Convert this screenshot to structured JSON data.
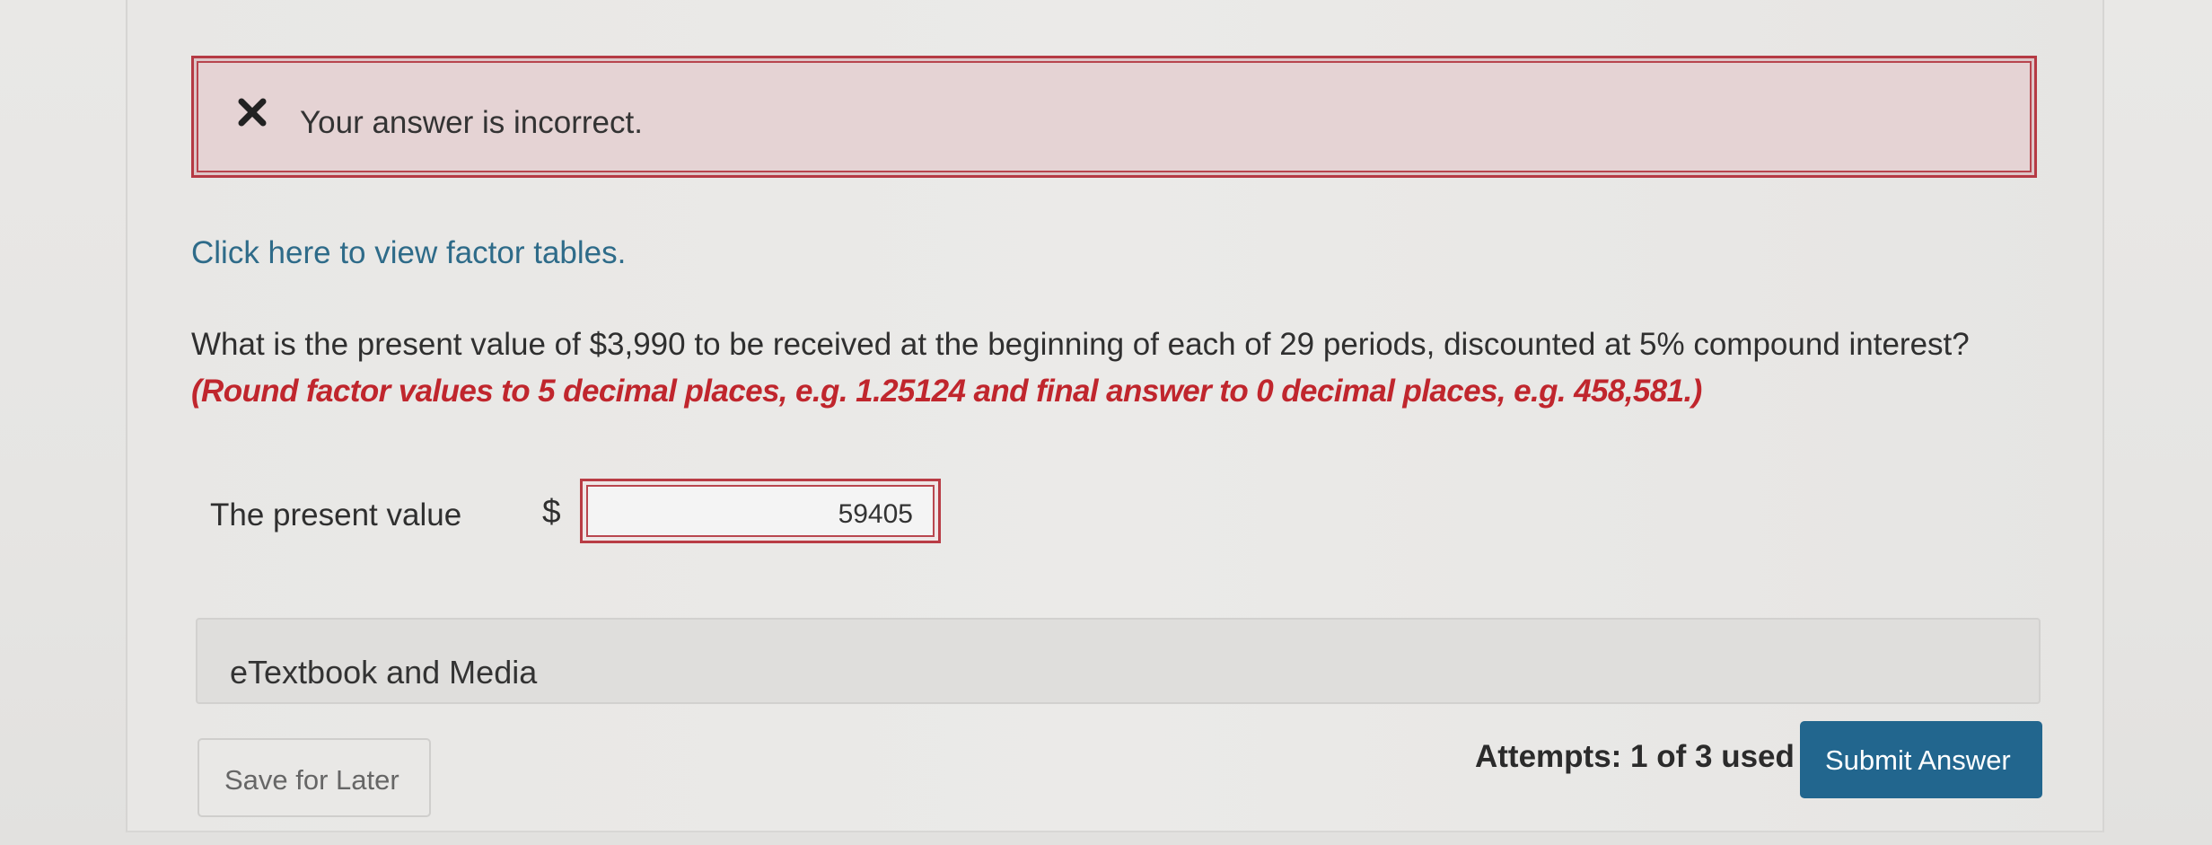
{
  "alert": {
    "icon": "close-icon",
    "message": "Your answer is incorrect.",
    "border_color": "#b53a44",
    "background_color": "#e5d3d4"
  },
  "factor_tables_link": "Click here to view factor tables.",
  "question": {
    "text": "What is the present value of $3,990 to be received at the beginning of each of 29 periods, discounted at 5% compound interest?",
    "hint": "(Round factor values to 5 decimal places, e.g. 1.25124 and final answer to 0 decimal places, e.g. 458,581.)",
    "hint_color": "#c0262d"
  },
  "answer": {
    "label": "The present value",
    "currency": "$",
    "value": "59405"
  },
  "etextbook": {
    "label": "eTextbook and Media"
  },
  "footer": {
    "save_label": "Save for Later",
    "attempts": "Attempts: 1 of 3 used",
    "submit_label": "Submit Answer",
    "submit_color": "#22668e"
  }
}
